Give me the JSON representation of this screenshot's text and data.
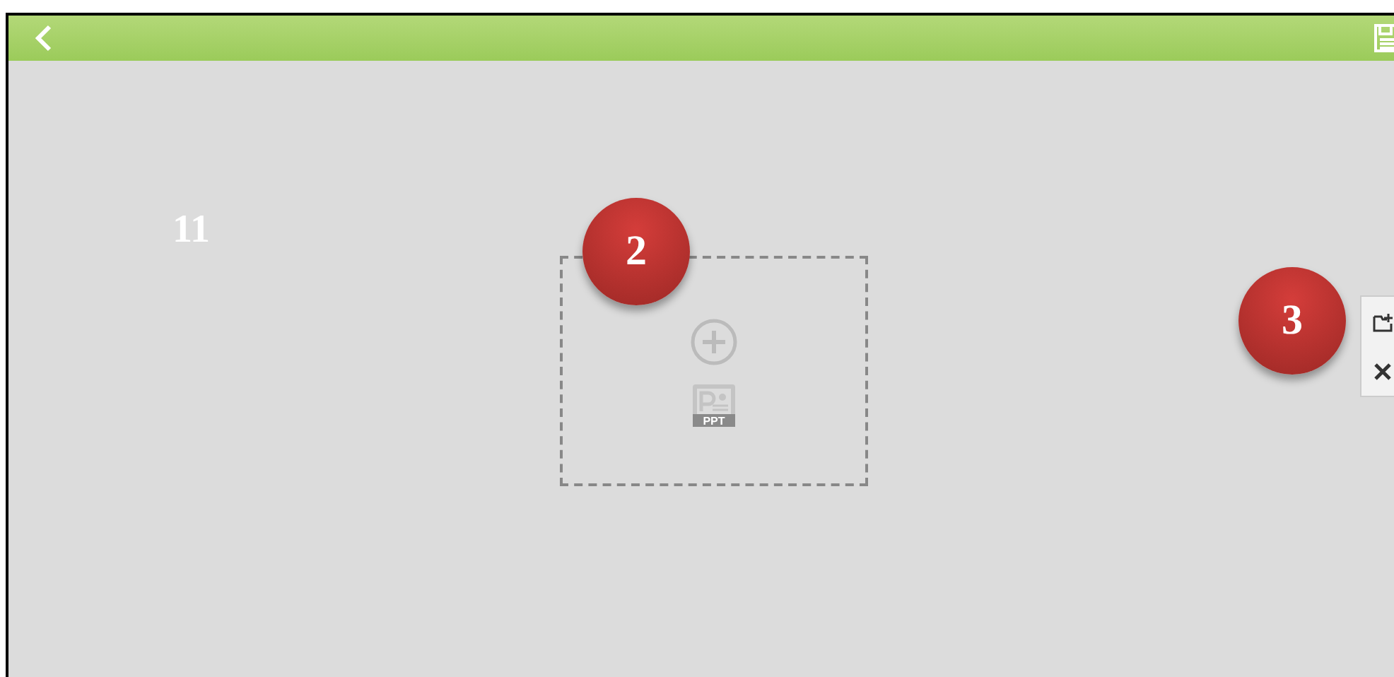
{
  "canvas_label": "11",
  "placeholder": {
    "file_label": "PPT"
  },
  "markers": [
    {
      "number": "2",
      "kind": "placeholder"
    },
    {
      "number": "3",
      "kind": "toolbar"
    }
  ]
}
